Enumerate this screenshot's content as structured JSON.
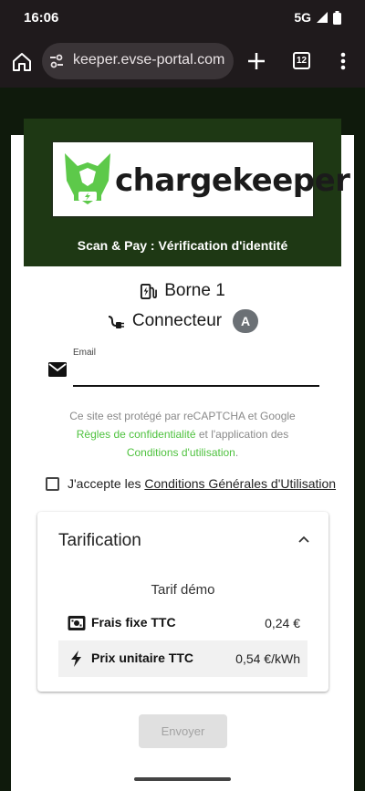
{
  "status_bar": {
    "time": "16:06",
    "network": "5G"
  },
  "browser": {
    "url": "keeper.evse-portal.com",
    "tab_count": "12"
  },
  "brand": {
    "logo_text": "chargekeeper",
    "subtitle": "Scan & Pay : Vérification d'identité"
  },
  "station": {
    "label": "Borne 1",
    "connector_label": "Connecteur",
    "connector_id": "A"
  },
  "email": {
    "label": "Email",
    "value": ""
  },
  "recaptcha": {
    "line1": "Ce site est protégé par reCAPTCHA et Google",
    "privacy_link": "Règles de confidentialité",
    "and_text": " et l'application des",
    "terms_link": "Conditions d'utilisation",
    "period": "."
  },
  "cgu": {
    "prefix": "J'accepte les ",
    "link": "Conditions Générales d'Utilisation",
    "checked": false
  },
  "pricing": {
    "title": "Tarification",
    "tariff_name": "Tarif démo",
    "rows": [
      {
        "icon": "cash-icon",
        "label": "Frais fixe TTC",
        "value": "0,24 €"
      },
      {
        "icon": "bolt-icon",
        "label": "Prix unitaire TTC",
        "value": "0,54 €/kWh"
      }
    ]
  },
  "submit_label": "Envoyer",
  "colors": {
    "brand_dark": "#1e3814",
    "link_green": "#4fc23f",
    "badge_gray": "#6b7075"
  }
}
